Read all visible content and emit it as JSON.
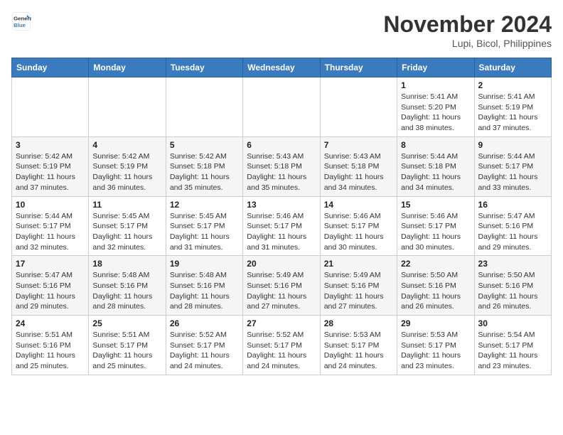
{
  "header": {
    "logo_line1": "General",
    "logo_line2": "Blue",
    "month": "November 2024",
    "location": "Lupi, Bicol, Philippines"
  },
  "weekdays": [
    "Sunday",
    "Monday",
    "Tuesday",
    "Wednesday",
    "Thursday",
    "Friday",
    "Saturday"
  ],
  "weeks": [
    [
      {
        "day": "",
        "info": ""
      },
      {
        "day": "",
        "info": ""
      },
      {
        "day": "",
        "info": ""
      },
      {
        "day": "",
        "info": ""
      },
      {
        "day": "",
        "info": ""
      },
      {
        "day": "1",
        "info": "Sunrise: 5:41 AM\nSunset: 5:20 PM\nDaylight: 11 hours\nand 38 minutes."
      },
      {
        "day": "2",
        "info": "Sunrise: 5:41 AM\nSunset: 5:19 PM\nDaylight: 11 hours\nand 37 minutes."
      }
    ],
    [
      {
        "day": "3",
        "info": "Sunrise: 5:42 AM\nSunset: 5:19 PM\nDaylight: 11 hours\nand 37 minutes."
      },
      {
        "day": "4",
        "info": "Sunrise: 5:42 AM\nSunset: 5:19 PM\nDaylight: 11 hours\nand 36 minutes."
      },
      {
        "day": "5",
        "info": "Sunrise: 5:42 AM\nSunset: 5:18 PM\nDaylight: 11 hours\nand 35 minutes."
      },
      {
        "day": "6",
        "info": "Sunrise: 5:43 AM\nSunset: 5:18 PM\nDaylight: 11 hours\nand 35 minutes."
      },
      {
        "day": "7",
        "info": "Sunrise: 5:43 AM\nSunset: 5:18 PM\nDaylight: 11 hours\nand 34 minutes."
      },
      {
        "day": "8",
        "info": "Sunrise: 5:44 AM\nSunset: 5:18 PM\nDaylight: 11 hours\nand 34 minutes."
      },
      {
        "day": "9",
        "info": "Sunrise: 5:44 AM\nSunset: 5:17 PM\nDaylight: 11 hours\nand 33 minutes."
      }
    ],
    [
      {
        "day": "10",
        "info": "Sunrise: 5:44 AM\nSunset: 5:17 PM\nDaylight: 11 hours\nand 32 minutes."
      },
      {
        "day": "11",
        "info": "Sunrise: 5:45 AM\nSunset: 5:17 PM\nDaylight: 11 hours\nand 32 minutes."
      },
      {
        "day": "12",
        "info": "Sunrise: 5:45 AM\nSunset: 5:17 PM\nDaylight: 11 hours\nand 31 minutes."
      },
      {
        "day": "13",
        "info": "Sunrise: 5:46 AM\nSunset: 5:17 PM\nDaylight: 11 hours\nand 31 minutes."
      },
      {
        "day": "14",
        "info": "Sunrise: 5:46 AM\nSunset: 5:17 PM\nDaylight: 11 hours\nand 30 minutes."
      },
      {
        "day": "15",
        "info": "Sunrise: 5:46 AM\nSunset: 5:17 PM\nDaylight: 11 hours\nand 30 minutes."
      },
      {
        "day": "16",
        "info": "Sunrise: 5:47 AM\nSunset: 5:16 PM\nDaylight: 11 hours\nand 29 minutes."
      }
    ],
    [
      {
        "day": "17",
        "info": "Sunrise: 5:47 AM\nSunset: 5:16 PM\nDaylight: 11 hours\nand 29 minutes."
      },
      {
        "day": "18",
        "info": "Sunrise: 5:48 AM\nSunset: 5:16 PM\nDaylight: 11 hours\nand 28 minutes."
      },
      {
        "day": "19",
        "info": "Sunrise: 5:48 AM\nSunset: 5:16 PM\nDaylight: 11 hours\nand 28 minutes."
      },
      {
        "day": "20",
        "info": "Sunrise: 5:49 AM\nSunset: 5:16 PM\nDaylight: 11 hours\nand 27 minutes."
      },
      {
        "day": "21",
        "info": "Sunrise: 5:49 AM\nSunset: 5:16 PM\nDaylight: 11 hours\nand 27 minutes."
      },
      {
        "day": "22",
        "info": "Sunrise: 5:50 AM\nSunset: 5:16 PM\nDaylight: 11 hours\nand 26 minutes."
      },
      {
        "day": "23",
        "info": "Sunrise: 5:50 AM\nSunset: 5:16 PM\nDaylight: 11 hours\nand 26 minutes."
      }
    ],
    [
      {
        "day": "24",
        "info": "Sunrise: 5:51 AM\nSunset: 5:16 PM\nDaylight: 11 hours\nand 25 minutes."
      },
      {
        "day": "25",
        "info": "Sunrise: 5:51 AM\nSunset: 5:17 PM\nDaylight: 11 hours\nand 25 minutes."
      },
      {
        "day": "26",
        "info": "Sunrise: 5:52 AM\nSunset: 5:17 PM\nDaylight: 11 hours\nand 24 minutes."
      },
      {
        "day": "27",
        "info": "Sunrise: 5:52 AM\nSunset: 5:17 PM\nDaylight: 11 hours\nand 24 minutes."
      },
      {
        "day": "28",
        "info": "Sunrise: 5:53 AM\nSunset: 5:17 PM\nDaylight: 11 hours\nand 24 minutes."
      },
      {
        "day": "29",
        "info": "Sunrise: 5:53 AM\nSunset: 5:17 PM\nDaylight: 11 hours\nand 23 minutes."
      },
      {
        "day": "30",
        "info": "Sunrise: 5:54 AM\nSunset: 5:17 PM\nDaylight: 11 hours\nand 23 minutes."
      }
    ]
  ]
}
